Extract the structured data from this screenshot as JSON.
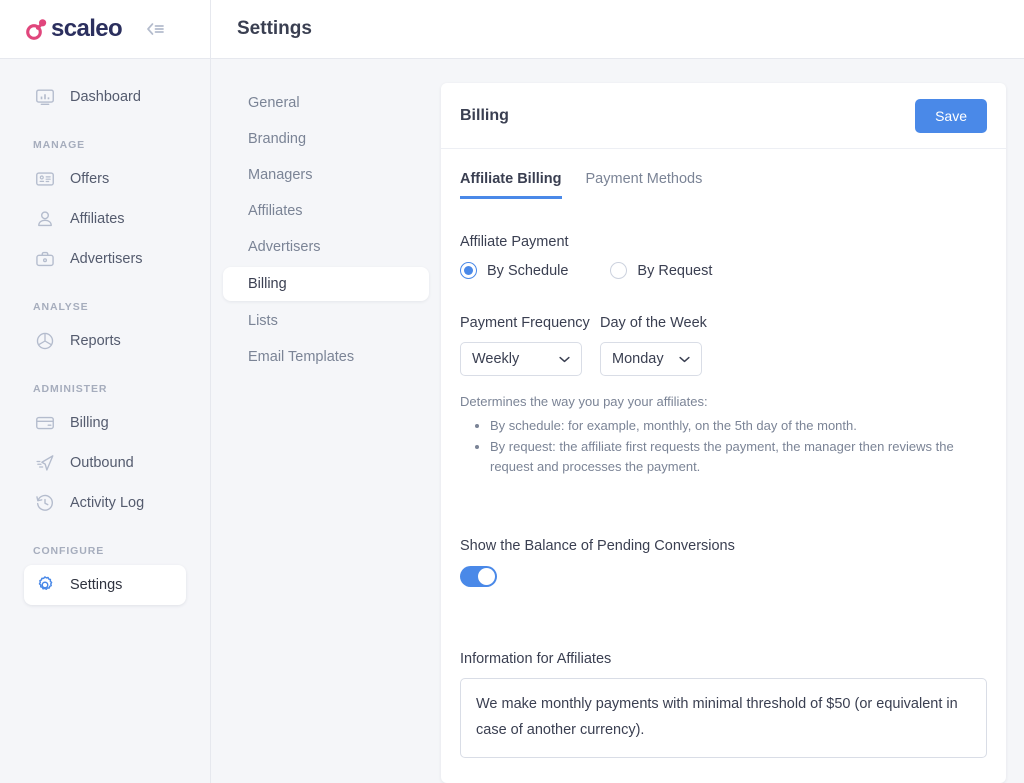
{
  "brand": {
    "name": "scaleo",
    "logo_color": "#e0467c",
    "text_color": "#2b2f5e",
    "collapse_icon": "collapse-sidebar-icon"
  },
  "sidebar": {
    "items": [
      {
        "label": "Dashboard",
        "icon": "dashboard-monitor-icon",
        "active": false
      },
      {
        "label": "Offers",
        "icon": "offer-card-icon",
        "active": false
      },
      {
        "label": "Affiliates",
        "icon": "user-icon",
        "active": false
      },
      {
        "label": "Advertisers",
        "icon": "briefcase-icon",
        "active": false
      },
      {
        "label": "Reports",
        "icon": "pie-chart-icon",
        "active": false
      },
      {
        "label": "Billing",
        "icon": "credit-card-icon",
        "active": false
      },
      {
        "label": "Outbound",
        "icon": "paper-plane-icon",
        "active": false
      },
      {
        "label": "Activity Log",
        "icon": "clock-history-icon",
        "active": false
      },
      {
        "label": "Settings",
        "icon": "gear-icon",
        "active": true
      }
    ],
    "groups": {
      "manage": "MANAGE",
      "analyse": "ANALYSE",
      "administer": "ADMINISTER",
      "configure": "CONFIGURE"
    }
  },
  "topbar": {
    "title": "Settings"
  },
  "subnav": {
    "items": [
      {
        "label": "General",
        "active": false
      },
      {
        "label": "Branding",
        "active": false
      },
      {
        "label": "Managers",
        "active": false
      },
      {
        "label": "Affiliates",
        "active": false
      },
      {
        "label": "Advertisers",
        "active": false
      },
      {
        "label": "Billing",
        "active": true
      },
      {
        "label": "Lists",
        "active": false
      },
      {
        "label": "Email Templates",
        "active": false
      }
    ]
  },
  "card": {
    "title": "Billing",
    "save_label": "Save",
    "accent_color": "#4a89e8",
    "tabs": [
      {
        "label": "Affiliate Billing",
        "active": true
      },
      {
        "label": "Payment Methods",
        "active": false
      }
    ],
    "affiliate_payment": {
      "label": "Affiliate Payment",
      "options": [
        {
          "label": "By Schedule",
          "checked": true
        },
        {
          "label": "By Request",
          "checked": false
        }
      ]
    },
    "payment_frequency": {
      "label": "Payment Frequency",
      "value": "Weekly"
    },
    "day_of_week": {
      "label": "Day of the Week",
      "value": "Monday"
    },
    "helper": {
      "intro": "Determines the way you pay your affiliates:",
      "bullets": [
        "By schedule: for example, monthly, on the 5th day of the month.",
        "By request: the affiliate first requests the payment, the manager then reviews the request and processes the payment."
      ]
    },
    "pending_conversions": {
      "label": "Show the Balance of Pending Conversions",
      "enabled": true
    },
    "information_for_affiliates": {
      "label": "Information for Affiliates",
      "value": "We make monthly payments with minimal threshold of $50 (or equivalent in case of another currency)."
    }
  }
}
